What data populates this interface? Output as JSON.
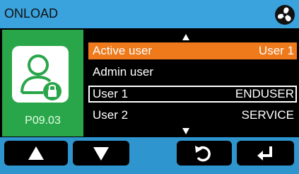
{
  "header": {
    "title": "ONLOAD",
    "fan_icon": "fan-icon"
  },
  "profile": {
    "id": "P09.03",
    "icon": "user-lock-icon"
  },
  "menu": {
    "rows": [
      {
        "label": "Active user",
        "value": "User 1",
        "state": "highlighted"
      },
      {
        "label": "Admin user",
        "value": "",
        "state": "normal"
      },
      {
        "label": "User 1",
        "value": "ENDUSER",
        "state": "selected"
      },
      {
        "label": "User 2",
        "value": "SERVICE",
        "state": "normal"
      }
    ],
    "scroll_up_icon": "scroll-up-arrow-icon",
    "scroll_down_icon": "scroll-down-arrow-icon"
  },
  "buttons": [
    {
      "name": "up-button",
      "icon": "triangle-up-icon"
    },
    {
      "name": "down-button",
      "icon": "triangle-down-icon"
    },
    {
      "name": "back-button",
      "icon": "rotate-back-icon"
    },
    {
      "name": "enter-button",
      "icon": "enter-return-icon"
    }
  ],
  "colors": {
    "frame": "#2f95cf",
    "profile_bg": "#2aa64a",
    "highlight": "#ee7a1c",
    "screen": "#000000"
  }
}
